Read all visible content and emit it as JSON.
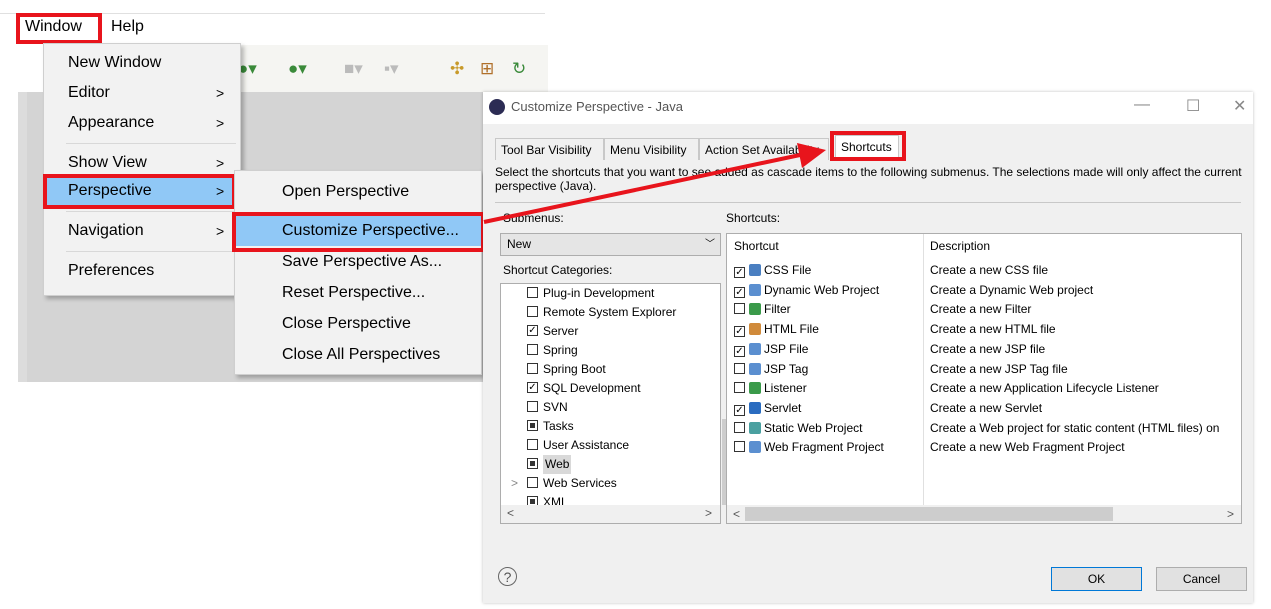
{
  "menubar": {
    "window": "Window",
    "help": "Help"
  },
  "main_menu": {
    "items": [
      {
        "label": "New Window",
        "arrow": ""
      },
      {
        "label": "Editor",
        "arrow": ">"
      },
      {
        "label": "Appearance",
        "arrow": ">"
      },
      {
        "label": "Show View",
        "arrow": ">"
      },
      {
        "label": "Perspective",
        "arrow": ">"
      },
      {
        "label": "Navigation",
        "arrow": ">"
      },
      {
        "label": "Preferences",
        "arrow": ""
      }
    ]
  },
  "submenu": {
    "items": [
      "Open Perspective",
      "Customize Perspective...",
      "Save Perspective As...",
      "Reset Perspective...",
      "Close Perspective",
      "Close All Perspectives"
    ]
  },
  "dialog": {
    "title": "Customize Perspective - Java",
    "tabs": [
      "Tool Bar Visibility",
      "Menu Visibility",
      "Action Set Availability",
      "Shortcuts"
    ],
    "active_tab": "Shortcuts",
    "description": "Select the shortcuts that you want to see added as cascade items to the following submenus.  The selections made will only affect the current perspective (Java).",
    "submenus_label": "Submenus:",
    "submenu_value": "New",
    "categories_label": "Shortcut Categories:",
    "shortcuts_label": "Shortcuts:",
    "categories": [
      {
        "name": "Plug-in Development",
        "state": "unchecked"
      },
      {
        "name": "Remote System Explorer",
        "state": "unchecked"
      },
      {
        "name": "Server",
        "state": "checked"
      },
      {
        "name": "Spring",
        "state": "unchecked"
      },
      {
        "name": "Spring Boot",
        "state": "unchecked"
      },
      {
        "name": "SQL Development",
        "state": "checked"
      },
      {
        "name": "SVN",
        "state": "unchecked"
      },
      {
        "name": "Tasks",
        "state": "partial"
      },
      {
        "name": "User Assistance",
        "state": "unchecked"
      },
      {
        "name": "Web",
        "state": "partial",
        "selected": true
      },
      {
        "name": "Web Services",
        "state": "unchecked",
        "expander": ">"
      },
      {
        "name": "XML",
        "state": "partial"
      }
    ],
    "columns": {
      "shortcut": "Shortcut",
      "description": "Description"
    },
    "shortcuts": [
      {
        "name": "CSS File",
        "checked": true,
        "icon": "css-file-icon",
        "color": "#4a7fc1",
        "description": "Create a new CSS file"
      },
      {
        "name": "Dynamic Web Project",
        "checked": true,
        "icon": "web-project-icon",
        "color": "#5b8fd0",
        "description": "Create a Dynamic Web project"
      },
      {
        "name": "Filter",
        "checked": false,
        "icon": "filter-icon",
        "color": "#3a9a4a",
        "description": "Create a new Filter"
      },
      {
        "name": "HTML File",
        "checked": true,
        "icon": "html-file-icon",
        "color": "#d08a3a",
        "description": "Create a new HTML file"
      },
      {
        "name": "JSP File",
        "checked": true,
        "icon": "jsp-file-icon",
        "color": "#5b8fd0",
        "description": "Create a new JSP file"
      },
      {
        "name": "JSP Tag",
        "checked": false,
        "icon": "jsp-tag-icon",
        "color": "#5b8fd0",
        "description": "Create a new JSP Tag file"
      },
      {
        "name": "Listener",
        "checked": false,
        "icon": "listener-icon",
        "color": "#3a9a4a",
        "description": "Create a new Application Lifecycle Listener"
      },
      {
        "name": "Servlet",
        "checked": true,
        "icon": "servlet-icon",
        "color": "#2a6cc0",
        "description": "Create a new Servlet"
      },
      {
        "name": "Static Web Project",
        "checked": false,
        "icon": "static-web-project-icon",
        "color": "#4aa0a0",
        "description": "Create a Web project for static content (HTML files) on"
      },
      {
        "name": "Web Fragment Project",
        "checked": false,
        "icon": "web-fragment-project-icon",
        "color": "#5b8fd0",
        "description": "Create a new Web Fragment Project"
      }
    ],
    "ok": "OK",
    "cancel": "Cancel",
    "help": "?"
  },
  "colors": {
    "highlight": "#90c8f6",
    "annotation": "#e8141c"
  }
}
